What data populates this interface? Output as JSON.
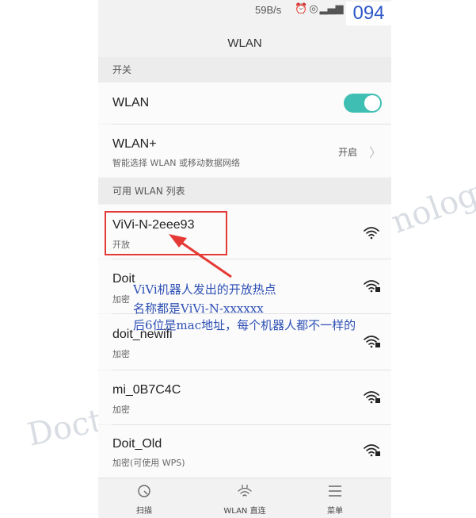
{
  "status_bar": {
    "speed": "59B/s",
    "icons": [
      "alarm-icon",
      "eye-icon",
      "signal-4g-icon",
      "battery-icon"
    ]
  },
  "corner_label": "094",
  "header": {
    "title": "WLAN"
  },
  "section_switch": {
    "label": "开关"
  },
  "wlan_toggle": {
    "label": "WLAN",
    "state": "on",
    "color": "#3fbfb3"
  },
  "wlan_plus": {
    "title": "WLAN+",
    "subtitle": "智能选择 WLAN 或移动数据网络",
    "value": "开启"
  },
  "section_list": {
    "label": "可用 WLAN 列表"
  },
  "networks": [
    {
      "ssid": "ViVi-N-2eee93",
      "security": "开放",
      "locked": false
    },
    {
      "ssid": "Doit",
      "security": "加密",
      "locked": true
    },
    {
      "ssid": "doit_newifi",
      "security": "加密",
      "locked": true
    },
    {
      "ssid": "mi_0B7C4C",
      "security": "加密",
      "locked": true
    },
    {
      "ssid": "Doit_Old",
      "security": "加密(可使用 WPS)",
      "locked": true
    }
  ],
  "annotation": {
    "line1": "ViVi机器人发出的开放热点",
    "line2": "名称都是ViVi-N-xxxxxx",
    "line3": "后6位是mac地址，每个机器人都不一样的",
    "box_color": "#e53935",
    "text_color": "#2d4fb4"
  },
  "bottom_tabs": [
    {
      "label": "扫描",
      "icon": "scan-icon"
    },
    {
      "label": "WLAN 直连",
      "icon": "wifi-direct-icon"
    },
    {
      "label": "菜单",
      "icon": "menu-icon"
    }
  ],
  "watermark": {
    "left": "Doctor",
    "right": "nology"
  }
}
